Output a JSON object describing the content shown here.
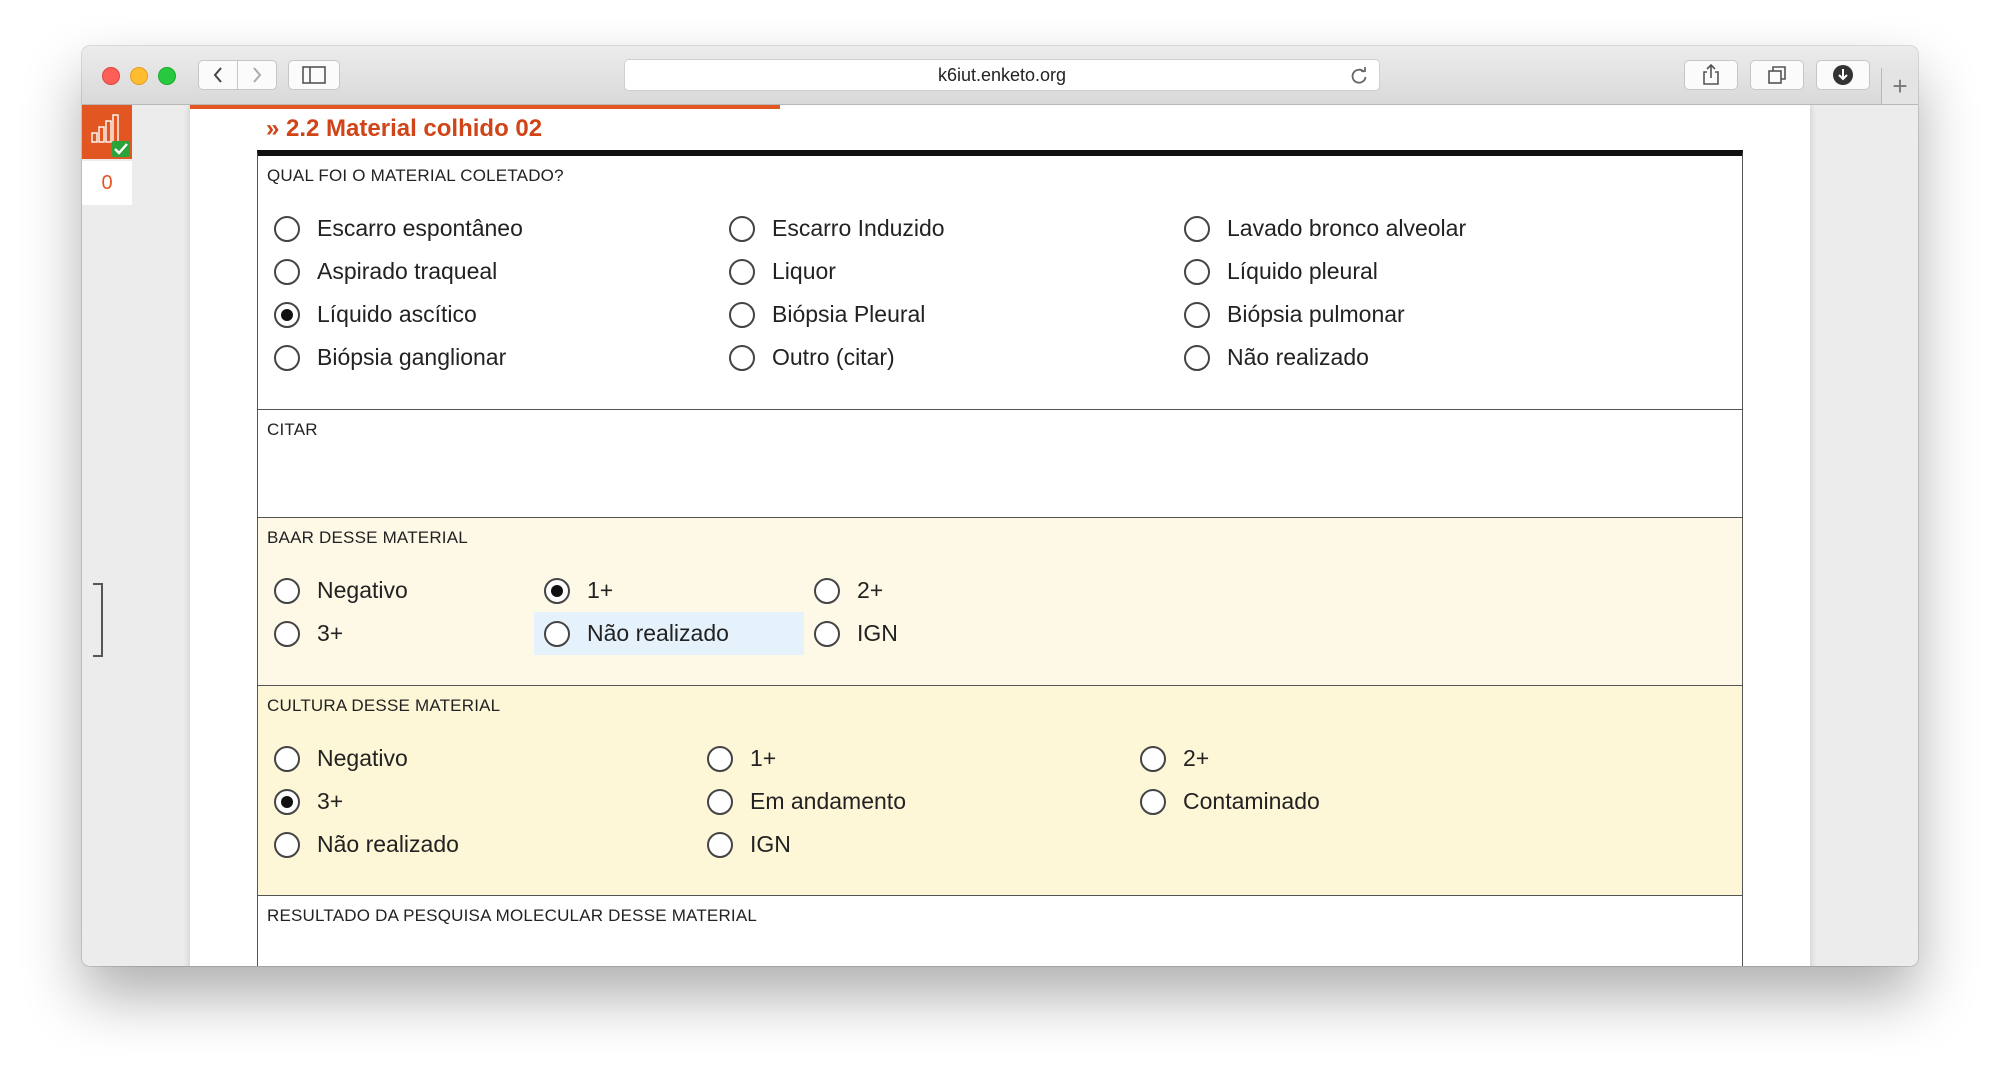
{
  "browser": {
    "url": "k6iut.enketo.org",
    "new_tab": "+"
  },
  "sidebar": {
    "queue_count": "0"
  },
  "form": {
    "section_title": "» 2.2 Material colhido 02",
    "questions": {
      "material": {
        "label": "QUAL FOI O MATERIAL COLETADO?",
        "options": [
          {
            "label": "Escarro espontâneo",
            "selected": false
          },
          {
            "label": "Escarro Induzido",
            "selected": false
          },
          {
            "label": "Lavado bronco alveolar",
            "selected": false
          },
          {
            "label": "Aspirado traqueal",
            "selected": false
          },
          {
            "label": "Liquor",
            "selected": false
          },
          {
            "label": "Líquido pleural",
            "selected": false
          },
          {
            "label": "Líquido ascítico",
            "selected": true
          },
          {
            "label": "Biópsia Pleural",
            "selected": false
          },
          {
            "label": "Biópsia pulmonar",
            "selected": false
          },
          {
            "label": "Biópsia ganglionar",
            "selected": false
          },
          {
            "label": "Outro (citar)",
            "selected": false
          },
          {
            "label": "Não realizado",
            "selected": false
          }
        ]
      },
      "citar": {
        "label": "CITAR",
        "value": ""
      },
      "baar": {
        "label": "BAAR DESSE MATERIAL",
        "background": "#fdf9e6",
        "options": [
          {
            "label": "Negativo",
            "selected": false
          },
          {
            "label": "1+",
            "selected": true
          },
          {
            "label": "2+",
            "selected": false
          },
          {
            "label": "3+",
            "selected": false
          },
          {
            "label": "Não realizado",
            "selected": false
          },
          {
            "label": "IGN",
            "selected": false
          }
        ]
      },
      "cultura": {
        "label": "CULTURA DESSE MATERIAL",
        "background": "#fdf6d7",
        "options": [
          {
            "label": "Negativo",
            "selected": false
          },
          {
            "label": "1+",
            "selected": false
          },
          {
            "label": "2+",
            "selected": false
          },
          {
            "label": "3+",
            "selected": true
          },
          {
            "label": "Em andamento",
            "selected": false
          },
          {
            "label": "Contaminado",
            "selected": false
          },
          {
            "label": "Não realizado",
            "selected": false
          },
          {
            "label": "IGN",
            "selected": false
          }
        ]
      },
      "molecular": {
        "label": "RESULTADO DA PESQUISA MOLECULAR DESSE MATERIAL"
      }
    }
  },
  "colors": {
    "accent": "#e25622",
    "title": "#d04418",
    "hover_highlight": "#e5f2fc"
  }
}
